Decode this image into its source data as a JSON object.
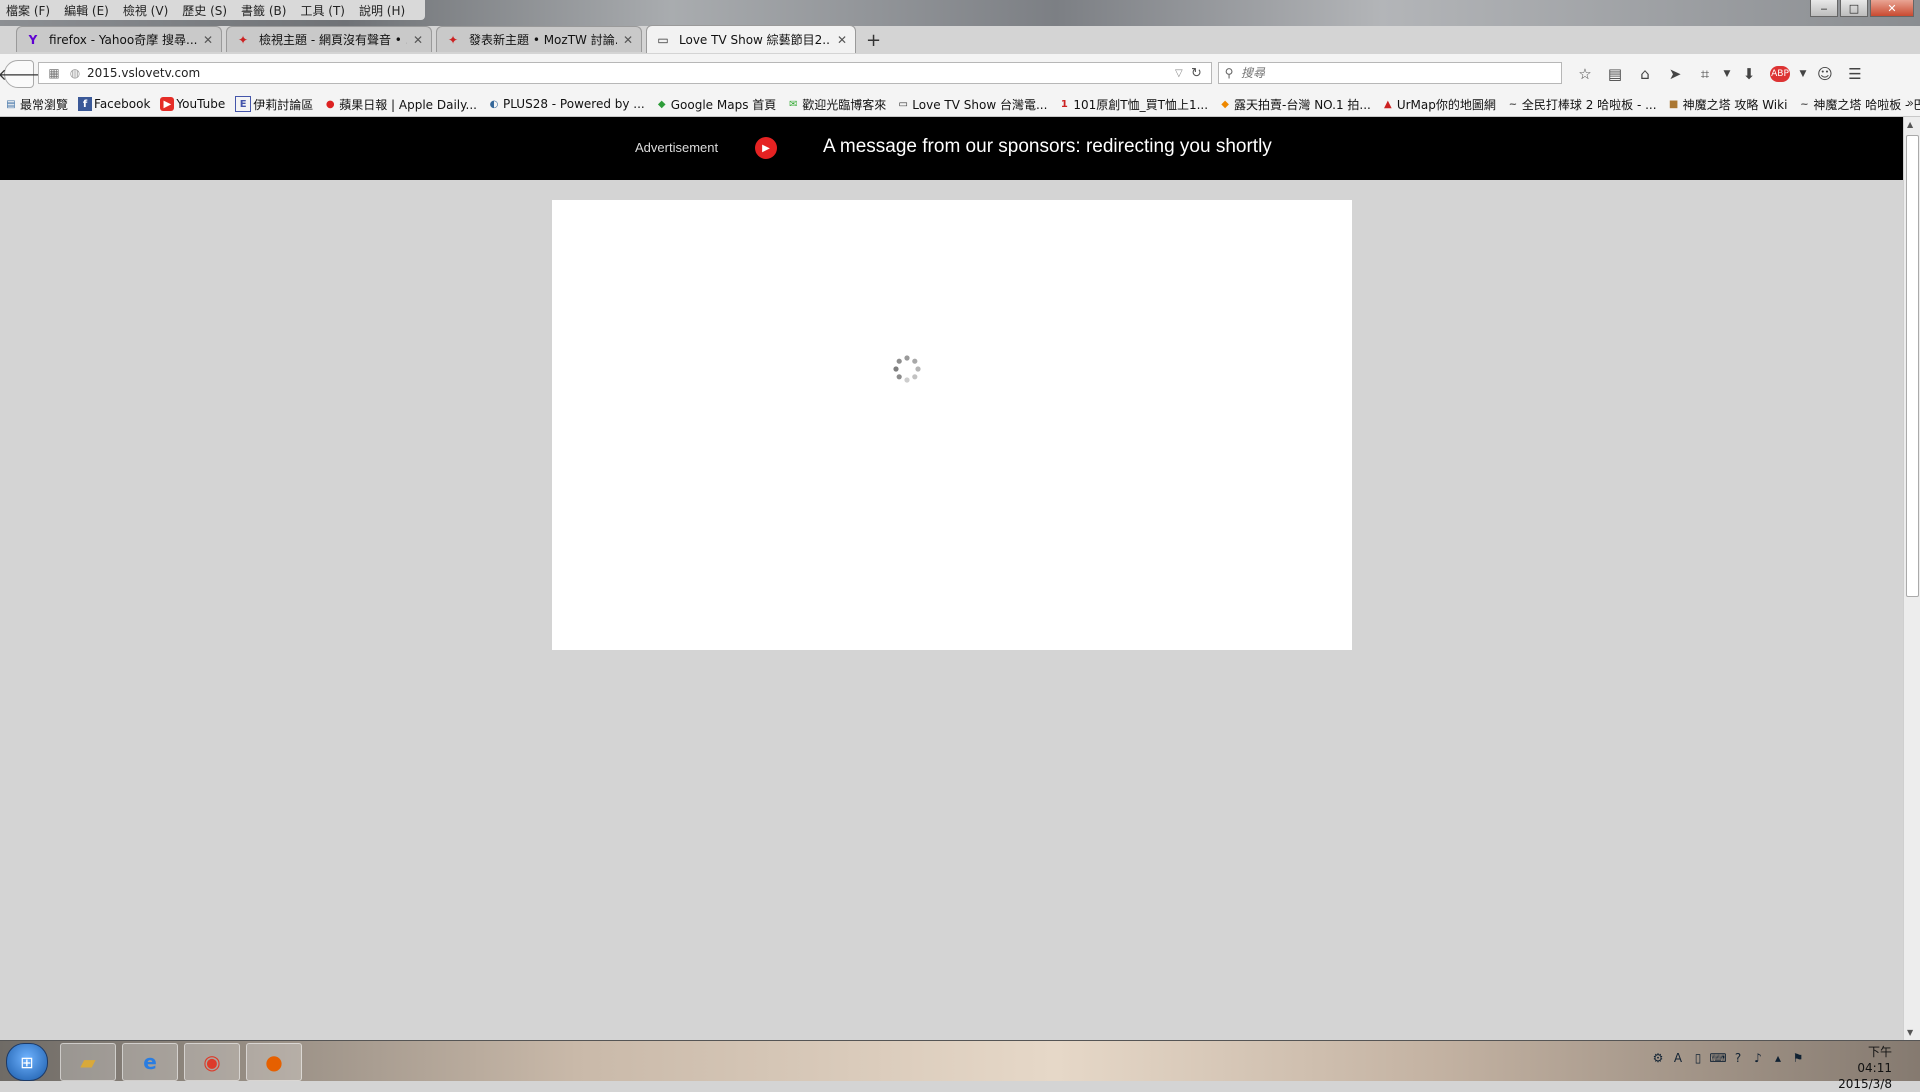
{
  "menu": [
    "檔案 (F)",
    "編輯 (E)",
    "檢視 (V)",
    "歷史 (S)",
    "書籤 (B)",
    "工具 (T)",
    "說明 (H)"
  ],
  "window_controls": [
    "‒",
    "□",
    "✕"
  ],
  "tabs": [
    {
      "title": "firefox - Yahoo奇摩 搜尋...",
      "icon": "Y",
      "icon_color": "#5f01d1"
    },
    {
      "title": "檢視主題 - 網頁沒有聲音 • ...",
      "icon": "✦",
      "icon_color": "#cc2222"
    },
    {
      "title": "發表新主題 • MozTW 討論...",
      "icon": "✦",
      "icon_color": "#cc2222"
    },
    {
      "title": "Love TV Show 綜藝節目2...",
      "icon": "▭",
      "icon_color": "#333333",
      "active": true
    }
  ],
  "new_tab": "+",
  "url": {
    "host": "2015.vslovetv.com"
  },
  "search": {
    "placeholder": "搜尋"
  },
  "bookmarks": [
    {
      "label": "最常瀏覽",
      "icon": "▤",
      "color": "#3a6ea5"
    },
    {
      "label": "Facebook",
      "icon": "f",
      "color": "#3b5998"
    },
    {
      "label": "YouTube",
      "icon": "▶",
      "color": "#e52d27"
    },
    {
      "label": "伊莉討論區",
      "icon": "E",
      "color": "#4455aa"
    },
    {
      "label": "蘋果日報 | Apple Daily...",
      "icon": "●",
      "color": "#dd2222"
    },
    {
      "label": "PLUS28 - Powered by ...",
      "icon": "◐",
      "color": "#336699"
    },
    {
      "label": "Google Maps 首頁",
      "icon": "◆",
      "color": "#2e9d3a"
    },
    {
      "label": "歡迎光臨博客來",
      "icon": "✉",
      "color": "#33aa33"
    },
    {
      "label": "Love TV Show 台灣電...",
      "icon": "▭",
      "color": "#333333"
    },
    {
      "label": "101原創T恤_買T恤上1...",
      "icon": "1",
      "color": "#cc2222"
    },
    {
      "label": "露天拍賣-台灣 NO.1 拍...",
      "icon": "◆",
      "color": "#ee8800"
    },
    {
      "label": "UrMap你的地圖網",
      "icon": "▲",
      "color": "#cc2222"
    },
    {
      "label": "全民打棒球 2 哈啦板 - ...",
      "icon": "~",
      "color": "#555555"
    },
    {
      "label": "神魔之塔 攻略 Wiki",
      "icon": "■",
      "color": "#aa7733"
    },
    {
      "label": "神魔之塔 哈啦板 - 巴哈...",
      "icon": "~",
      "color": "#555555"
    }
  ],
  "ad": {
    "label": "Advertisement",
    "message": "A message from our sponsors: redirecting you shortly"
  },
  "taskbar": {
    "time": "下午 04:11",
    "date": "2015/3/8"
  }
}
